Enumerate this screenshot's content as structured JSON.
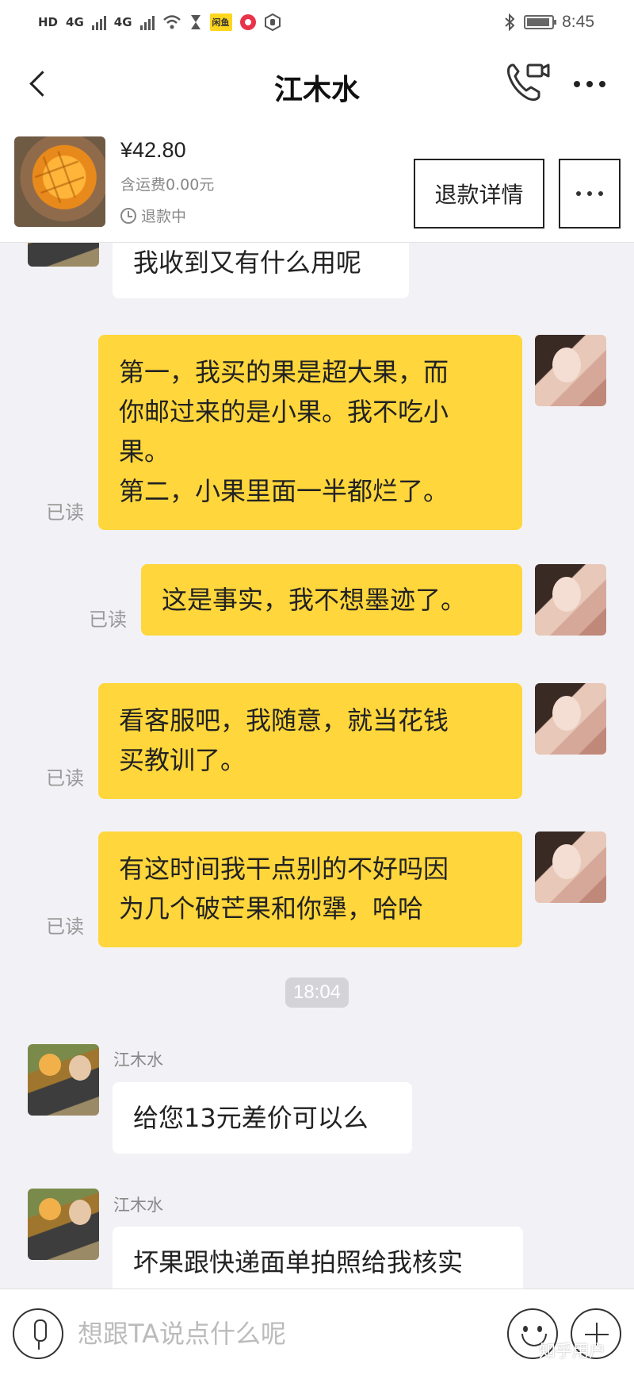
{
  "status_bar": {
    "left_chip": "HD",
    "net1": "4G",
    "net2": "4G",
    "badge": "闲鱼",
    "time": "8:45"
  },
  "header": {
    "title": "江木水"
  },
  "product": {
    "price": "¥42.80",
    "shipping": "含运费0.00元",
    "status": "退款中",
    "refund_button": "退款详情"
  },
  "messages": {
    "m0": {
      "text": "我收到又有什么用呢"
    },
    "m1": {
      "line1": "第一，我买的果是超大果，而",
      "line2": "你邮过来的是小果。我不吃小",
      "line3": "果。",
      "line4": "第二，小果里面一半都烂了。",
      "read": "已读"
    },
    "m2": {
      "text": "这是事实，我不想墨迹了。",
      "read": "已读"
    },
    "m3": {
      "line1": "看客服吧，我随意，就当花钱",
      "line2": "买教训了。",
      "read": "已读"
    },
    "m4": {
      "line1": "有这时间我干点别的不好吗因",
      "line2": "为几个破芒果和你犟，哈哈",
      "read": "已读"
    },
    "time": "18:04",
    "m5": {
      "sender": "江木水",
      "text": "给您13元差价可以么"
    },
    "m6": {
      "sender": "江木水",
      "text": "坏果跟快递面单拍照给我核实"
    }
  },
  "input": {
    "placeholder": "想跟TA说点什么呢"
  },
  "watermark": "知乎用户",
  "colors": {
    "my_bubble": "#ffd63b",
    "seller_bubble": "#ffffff",
    "chat_background": "#f2f2f6"
  }
}
